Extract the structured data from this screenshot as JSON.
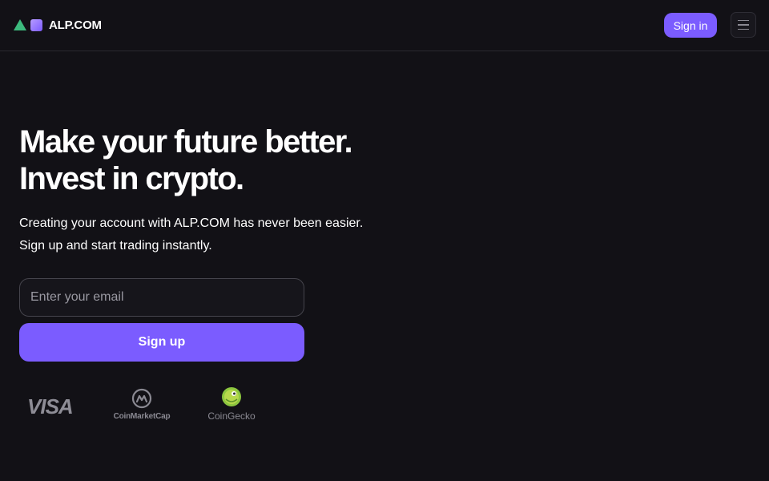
{
  "header": {
    "logo_text": "ALP.COM",
    "signin_label": "Sign in",
    "menu_icon": "hamburger-menu-icon"
  },
  "hero": {
    "title_line1": "Make your future better.",
    "title_line2": "Invest in crypto.",
    "subtitle_line1": "Creating your account with ALP.COM has never been easier.",
    "subtitle_line2": "Sign up and start trading instantly."
  },
  "form": {
    "email_placeholder": "Enter your email",
    "email_value": "",
    "signup_label": "Sign up"
  },
  "partners": {
    "visa_label": "VISA",
    "coinmarketcap_label": "CoinMarketCap",
    "coingecko_label": "CoinGecko"
  },
  "colors": {
    "background": "#121116",
    "accent": "#7b5cff",
    "logo_triangle": "#3dbb7e"
  }
}
